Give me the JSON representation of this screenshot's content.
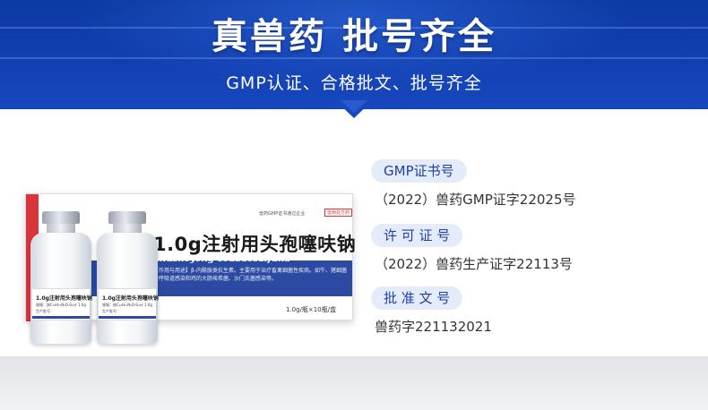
{
  "banner": {
    "title": "真兽药 批号齐全",
    "subtitle": "GMP认证、合格批文、批号齐全"
  },
  "product": {
    "box_gmp_text": "兽药GMP证书通过企业",
    "box_badge": "兽用处方药",
    "name": "1.0g注射用头孢噻呋钠",
    "pinyin": "Zhusheyong Toubaosaifuna",
    "usage": "【作用与用途】β-内酰胺类抗生素。主要用于治疗畜禽细菌性疾病。如牛、猪细菌性呼吸道感染和鸡的大肠埃希菌、沙门氏菌感染等。",
    "spec": "1.0g/瓶×10瓶/盒",
    "vial_label_name": "1.0g注射用头孢噻呋钠",
    "vial_label_spec": "规格：按C₁₉H₁₇N₅O₇S₃计 1.0g",
    "vial_label_date": "生产批号："
  },
  "info": {
    "items": [
      {
        "label": "GMP证书号",
        "value": "（2022）兽药GMP证字22025号"
      },
      {
        "label": "许 可 证 号",
        "value": "（2022）兽药生产证字22113号"
      },
      {
        "label": "批 准 文 号",
        "value": "兽药字221132021"
      }
    ]
  },
  "colors": {
    "banner_blue": "#123fb0",
    "pill_bg": "#e4ecf9",
    "pill_text": "#1e3fa8",
    "accent_red": "#d9343a"
  }
}
